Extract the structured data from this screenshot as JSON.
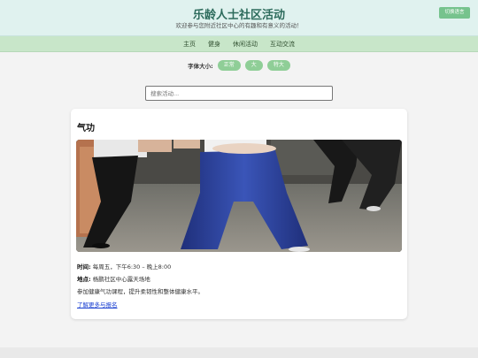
{
  "header": {
    "title": "乐龄人士社区活动",
    "subtitle": "欢迎参与您附近社区中心的有趣和有意义的活动！",
    "lang_button": "切换语言"
  },
  "nav": {
    "items": [
      "主页",
      "健身",
      "休闲活动",
      "互动交流"
    ]
  },
  "font_size": {
    "label": "字体大小:",
    "options": [
      "正常",
      "大",
      "特大"
    ]
  },
  "search": {
    "placeholder": "搜索活动..."
  },
  "activity": {
    "title": "气功",
    "time_label": "时间:",
    "time_value": "每周五，下午6:30 – 晚上8:00",
    "location_label": "地点:",
    "location_value": "杨鹏社区中心露天场地",
    "description": "参加健康气功课程，提升柔韧性和整体健康水平。",
    "link": "了解更多与报名"
  },
  "colors": {
    "header_bg": "#e0f2ef",
    "nav_bg": "#c8e6c9",
    "accent": "#76c38d",
    "link": "#1a3fd1"
  }
}
